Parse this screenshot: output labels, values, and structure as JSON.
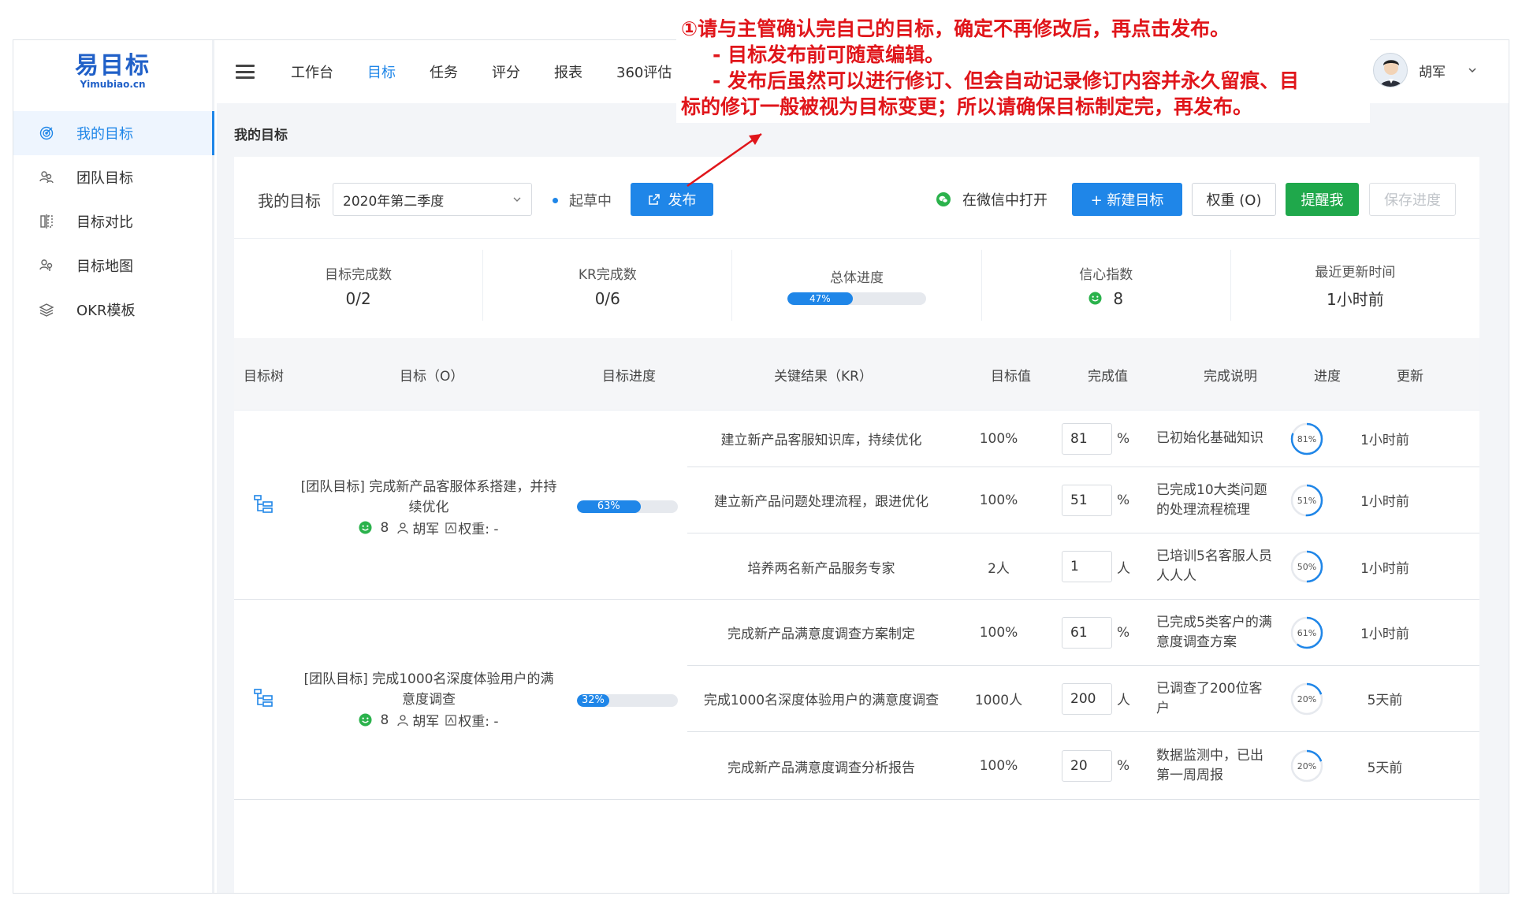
{
  "logo": {
    "cn": "易目标",
    "en": "Yimubiao.cn"
  },
  "sidebar": {
    "items": [
      {
        "label": "我的目标",
        "icon": "target-icon",
        "active": true
      },
      {
        "label": "团队目标",
        "icon": "team-icon",
        "active": false
      },
      {
        "label": "目标对比",
        "icon": "compare-icon",
        "active": false
      },
      {
        "label": "目标地图",
        "icon": "map-icon",
        "active": false
      },
      {
        "label": "OKR模板",
        "icon": "layers-icon",
        "active": false
      }
    ]
  },
  "topnav": {
    "items": [
      "工作台",
      "目标",
      "任务",
      "评分",
      "报表",
      "360评估"
    ],
    "active": "目标",
    "user_name": "胡军"
  },
  "page_title": "我的目标",
  "toolbar": {
    "label": "我的目标",
    "period": "2020年第二季度",
    "status": "起草中",
    "publish": "发布",
    "wechat": "在微信中打开",
    "new_goal": "+  新建目标",
    "weight": "权重 (O)",
    "remind": "提醒我",
    "save": "保存进度"
  },
  "stats": {
    "goal_done_label": "目标完成数",
    "goal_done": "0/2",
    "kr_done_label": "KR完成数",
    "kr_done": "0/6",
    "progress_label": "总体进度",
    "progress": 47,
    "progress_text": "47%",
    "confidence_label": "信心指数",
    "confidence": "8",
    "updated_label": "最近更新时间",
    "updated": "1小时前"
  },
  "table": {
    "headers": [
      "目标树",
      "目标（O）",
      "目标进度",
      "关键结果（KR）",
      "目标值",
      "完成值",
      "完成说明",
      "进度",
      "更新"
    ],
    "objectives": [
      {
        "title": "[团队目标] 完成新产品客服体系搭建，并持续优化",
        "confidence": "8",
        "owner": "胡军",
        "weight": "权重: -",
        "progress": 63,
        "progress_text": "63%",
        "krs": [
          {
            "name": "建立新产品客服知识库，持续优化",
            "target": "100%",
            "value": "81",
            "unit": "%",
            "desc": "已初始化基础知识",
            "pct": 81,
            "pct_text": "81%",
            "updated": "1小时前"
          },
          {
            "name": "建立新产品问题处理流程，跟进优化",
            "target": "100%",
            "value": "51",
            "unit": "%",
            "desc": "已完成10大类问题的处理流程梳理",
            "pct": 51,
            "pct_text": "51%",
            "updated": "1小时前"
          },
          {
            "name": "培养两名新产品服务专家",
            "target": "2人",
            "value": "1",
            "unit": "人",
            "desc": "已培训5名客服人员人人人",
            "pct": 50,
            "pct_text": "50%",
            "updated": "1小时前"
          }
        ]
      },
      {
        "title": "[团队目标] 完成1000名深度体验用户的满意度调查",
        "confidence": "8",
        "owner": "胡军",
        "weight": "权重: -",
        "progress": 32,
        "progress_text": "32%",
        "krs": [
          {
            "name": "完成新产品满意度调查方案制定",
            "target": "100%",
            "value": "61",
            "unit": "%",
            "desc": "已完成5类客户的满意度调查方案",
            "pct": 61,
            "pct_text": "61%",
            "updated": "1小时前"
          },
          {
            "name": "完成1000名深度体验用户的满意度调查",
            "target": "1000人",
            "value": "200",
            "unit": "人",
            "desc": "已调查了200位客户",
            "pct": 20,
            "pct_text": "20%",
            "updated": "5天前"
          },
          {
            "name": "完成新产品满意度调查分析报告",
            "target": "100%",
            "value": "20",
            "unit": "%",
            "desc": "数据监测中，已出第一周周报",
            "pct": 20,
            "pct_text": "20%",
            "updated": "5天前"
          }
        ]
      }
    ]
  },
  "annotation": {
    "line1": "①请与主管确认完自己的目标，确定不再修改后，再点击发布。",
    "line2": "- 目标发布前可随意编辑。",
    "line3": "- 发布后虽然可以进行修订、但会自动记录修订内容并永久留痕、目",
    "line4": "标的修订一般被视为目标变更；所以请确保目标制定完，再发布。"
  },
  "colors": {
    "accent": "#1f86e8",
    "remind": "#1fa84b",
    "annotation": "#e0161b",
    "smile": "#2bb24c"
  }
}
